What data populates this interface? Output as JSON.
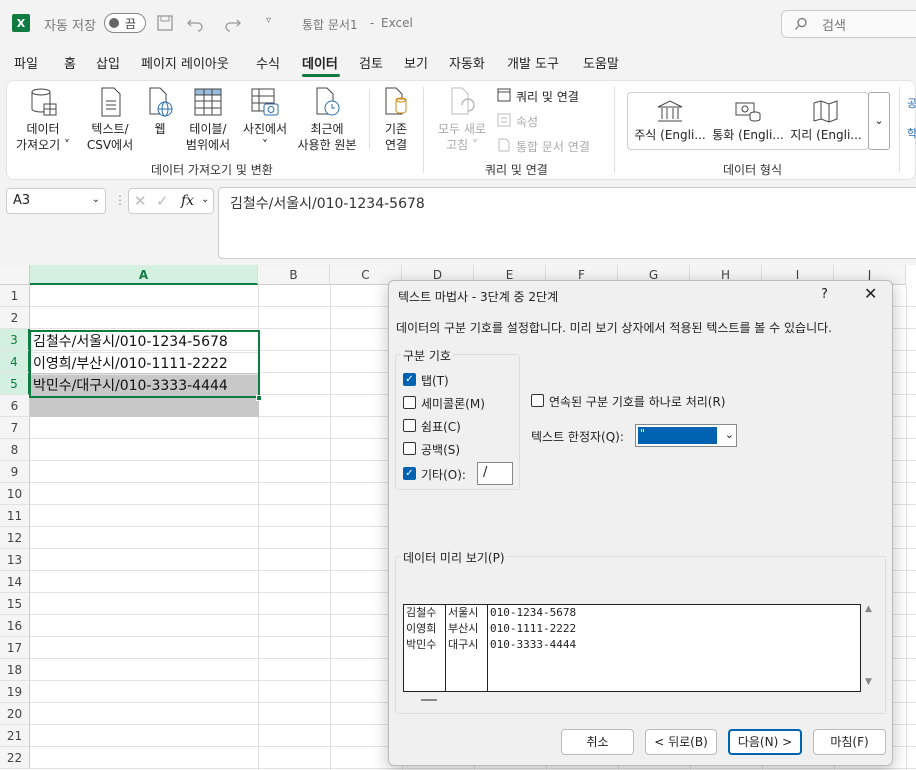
{
  "titlebar": {
    "autosave": "자동 저장",
    "autosave_state": "끔",
    "doc_title": "통합 문서1",
    "sep": "-",
    "app": "Excel",
    "search": "검색"
  },
  "menu": [
    "파일",
    "홈",
    "삽입",
    "페이지 레이아웃",
    "수식",
    "데이터",
    "검토",
    "보기",
    "자동화",
    "개발 도구",
    "도움말"
  ],
  "ribbon": {
    "get_data_l1": "데이터",
    "get_data_l2": "가져오기 ˅",
    "text_csv_l1": "텍스트/",
    "text_csv_l2": "CSV에서",
    "web": "웹",
    "table_l1": "테이블/",
    "table_l2": "범위에서",
    "picture_l1": "사진에서",
    "picture_l2": "˅",
    "recent_l1": "최근에",
    "recent_l2": "사용한 원본",
    "existing_l1": "기존",
    "existing_l2": "연결",
    "group1": "데이터 가져오기 및 변환",
    "refresh_l1": "모두 새로",
    "refresh_l2": "고침 ˅",
    "queries": "쿼리 및 연결",
    "properties": "속성",
    "edit_links": "통합 문서 연결",
    "group2": "쿼리 및 연결",
    "stocks": "주식 (Engli...",
    "currency": "통화 (Engli...",
    "geo": "지리 (Engli...",
    "group3": "데이터 형식",
    "more": "⌄",
    "edge1": "공",
    "edge2": "학"
  },
  "formula_bar": {
    "name_box": "A3",
    "fx": "fx",
    "value": "김철수/서울시/010-1234-5678"
  },
  "columns": [
    "A",
    "B",
    "C",
    "D",
    "E",
    "F",
    "G",
    "H",
    "I",
    "J"
  ],
  "rows": [
    "1",
    "2",
    "3",
    "4",
    "5",
    "6",
    "7",
    "8",
    "9",
    "10",
    "11",
    "12",
    "13",
    "14",
    "15",
    "16",
    "17",
    "18",
    "19",
    "20",
    "21",
    "22"
  ],
  "cells": {
    "a3": "김철수/서울시/010-1234-5678",
    "a4": "이영희/부산시/010-1111-2222",
    "a5": "박민수/대구시/010-3333-4444"
  },
  "dialog": {
    "title": "텍스트 마법사 - 3단계 중 2단계",
    "help": "?",
    "close": "✕",
    "description": "데이터의 구분 기호를 설정합니다. 미리 보기 상자에서 적용된 텍스트를 볼 수 있습니다.",
    "delimiters_label": "구분 기호",
    "delimiters": [
      {
        "label": "탭(T)",
        "checked": true
      },
      {
        "label": "세미콜론(M)",
        "checked": false
      },
      {
        "label": "쉼표(C)",
        "checked": false
      },
      {
        "label": "공백(S)",
        "checked": false
      },
      {
        "label": "기타(O):",
        "checked": true
      }
    ],
    "other_value": "/",
    "consecutive": "연속된 구분 기호를 하나로 처리(R)",
    "qualifier_label": "텍스트 한정자(Q):",
    "qualifier_value": "\"",
    "preview_label": "데이터 미리 보기(P)",
    "preview_columns": [
      [
        "김철수",
        "이영희",
        "박민수"
      ],
      [
        "서울시",
        "부산시",
        "대구시"
      ],
      [
        "010-1234-5678",
        "010-1111-2222",
        "010-3333-4444"
      ]
    ],
    "buttons": {
      "cancel": "취소",
      "back": "< 뒤로(B)",
      "next": "다음(N) >",
      "finish": "마침(F)"
    }
  }
}
